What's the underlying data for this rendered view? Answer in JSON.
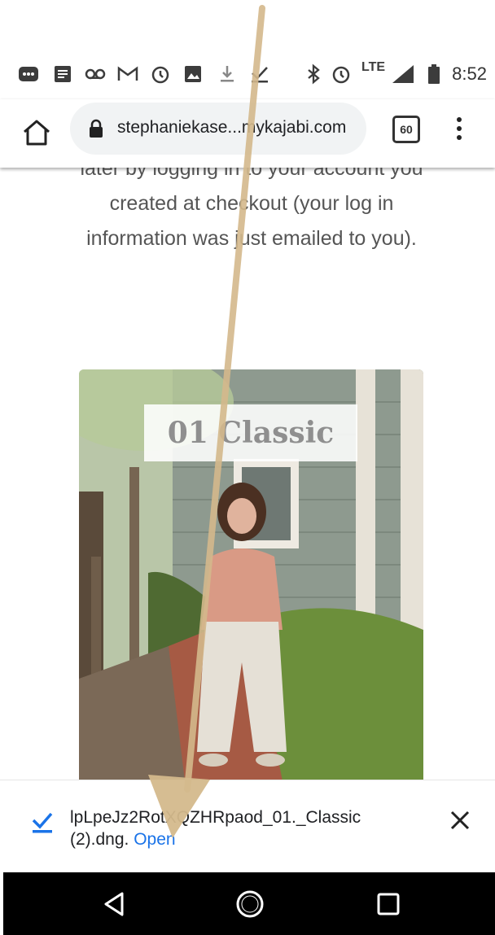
{
  "status_bar": {
    "time": "8:52",
    "network": "LTE",
    "icons": [
      "messages-icon",
      "news-icon",
      "voicemail-icon",
      "gmail-icon",
      "alarm-icon",
      "image-icon",
      "download-icon",
      "check-icon",
      "bluetooth-icon",
      "alarm-icon",
      "signal-icon",
      "battery-icon"
    ]
  },
  "browser": {
    "url": "stephaniekase...mykajabi.com",
    "tab_count": "60"
  },
  "page": {
    "lines": [
      "later by logging in to your account you",
      "created at checkout (your log in",
      "information was just emailed to you)."
    ],
    "image_label": "01 Classic"
  },
  "download": {
    "filename": "lpLpeJz2RotXQZHRpaod_01._Classic (2).dng.",
    "open_label": "Open"
  },
  "colors": {
    "accent": "#1a73e8",
    "arrow": "#d4b98c"
  }
}
